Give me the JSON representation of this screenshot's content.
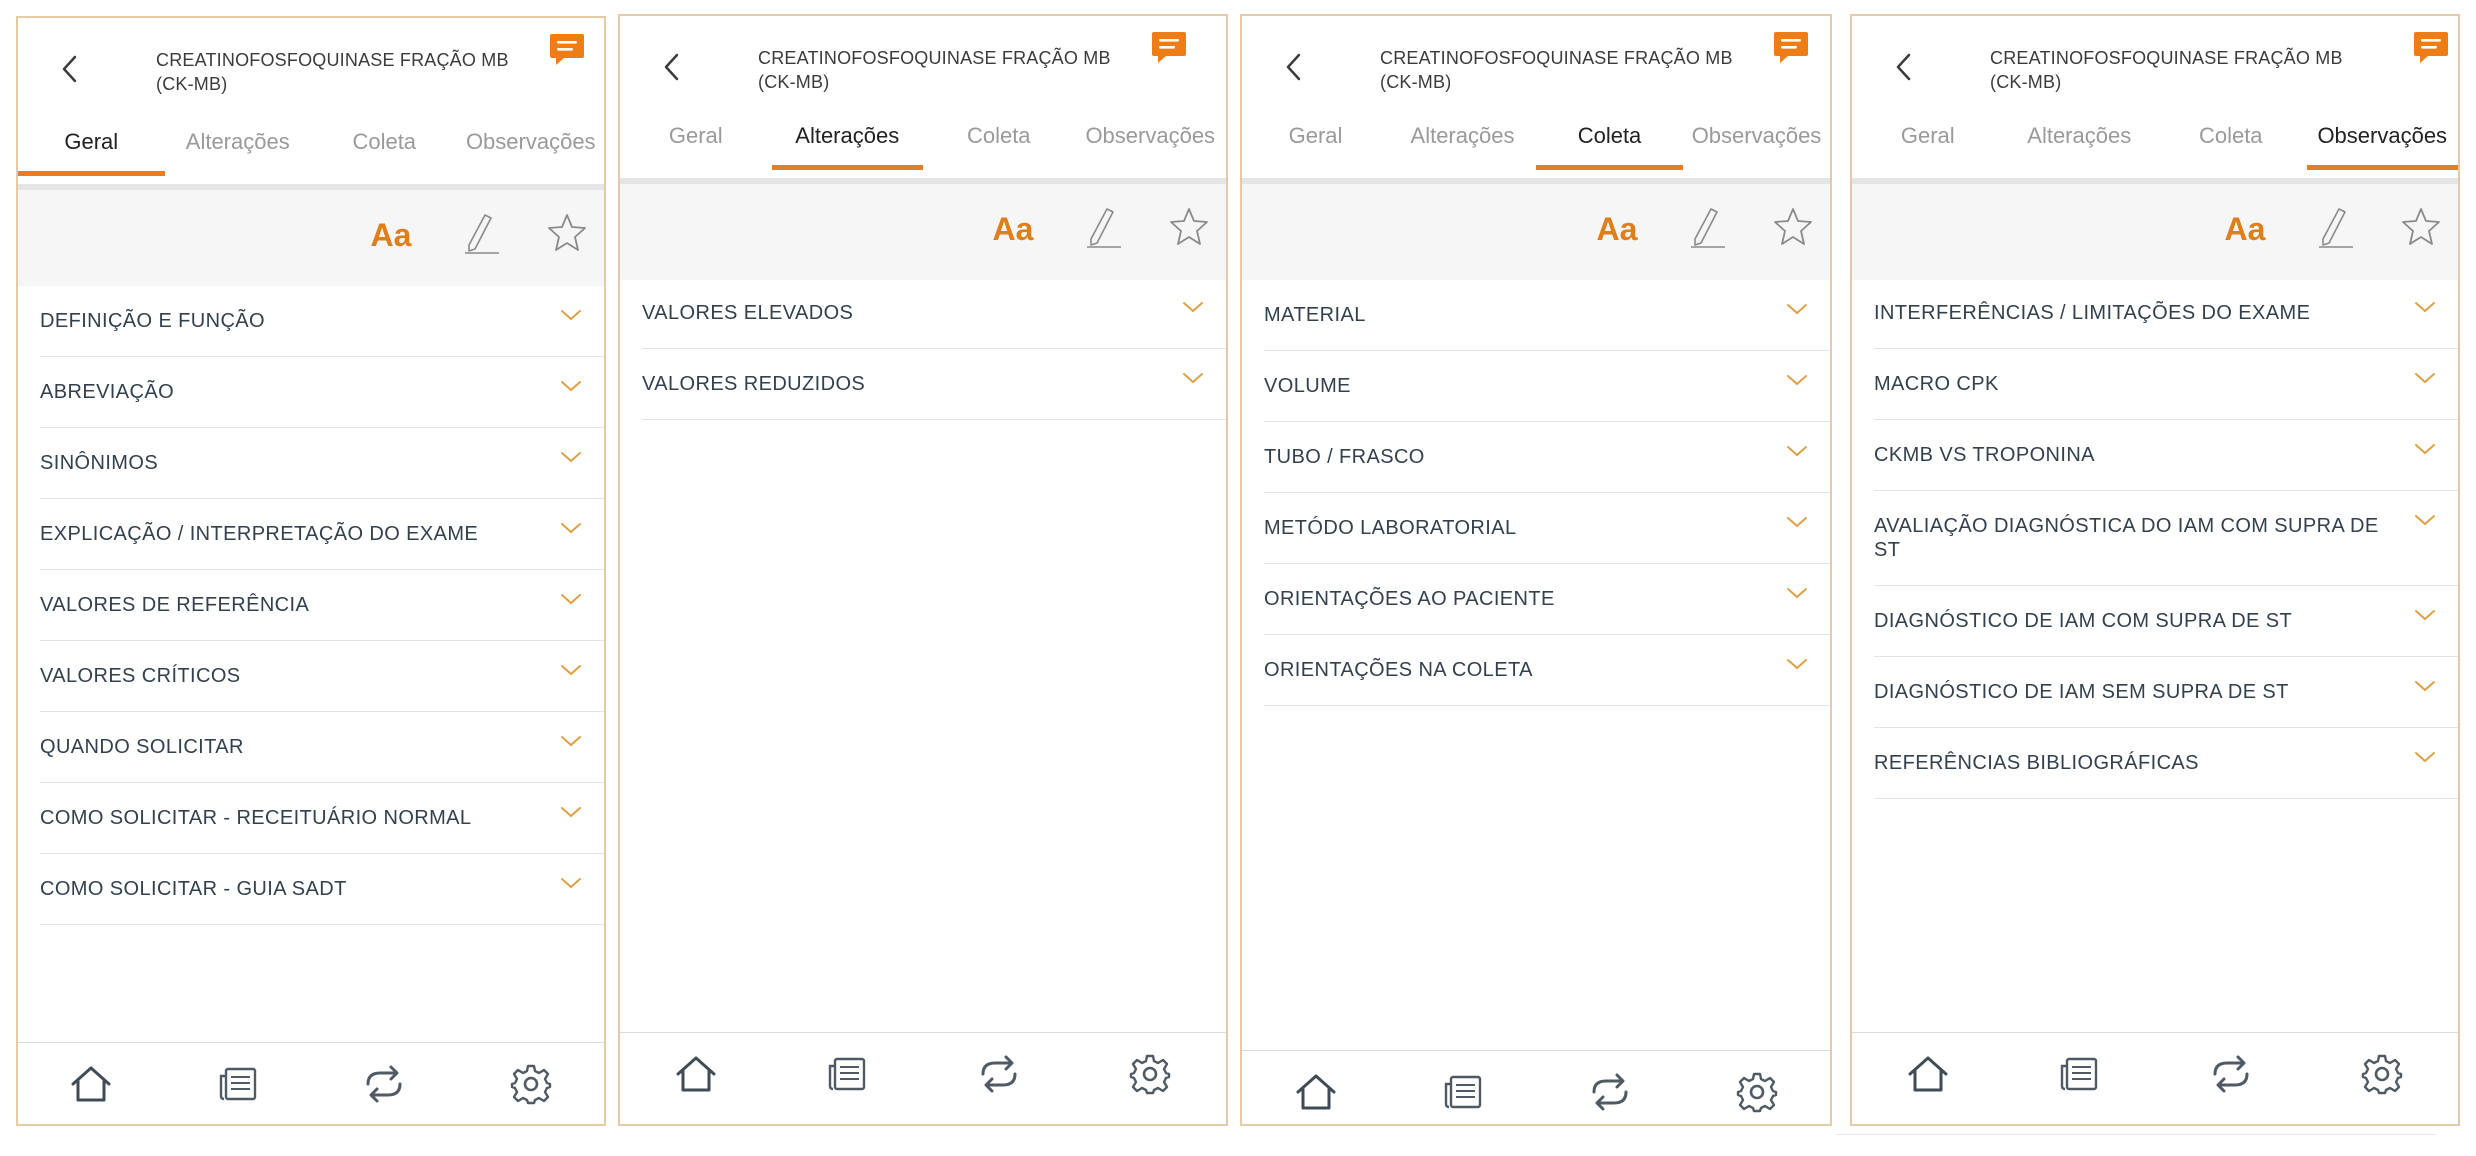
{
  "colors": {
    "accent": "#ec7d1f",
    "text": "#33404d",
    "tab_inactive": "#9a9a9a",
    "border": "#e6c9a6"
  },
  "icons": {
    "back": "chevron-left-icon",
    "chat": "chat-bubble-icon",
    "font_size": "font-size-icon",
    "pencil": "pencil-icon",
    "star": "star-icon",
    "chevron": "chevron-down-icon",
    "nav": [
      "home-icon",
      "news-icon",
      "refresh-icon",
      "gear-icon"
    ]
  },
  "header": {
    "title": "CREATINOFOSFOQUINASE FRAÇÃO MB (CK-MB)"
  },
  "tabs": [
    "Geral",
    "Alterações",
    "Coleta",
    "Observações"
  ],
  "toolbar": {
    "font_label": "Aa"
  },
  "panels": [
    {
      "active_tab": "Geral",
      "items": [
        "DEFINIÇÃO E FUNÇÃO",
        "ABREVIAÇÃO",
        "SINÔNIMOS",
        "EXPLICAÇÃO / INTERPRETAÇÃO DO EXAME",
        "VALORES DE REFERÊNCIA",
        "VALORES CRÍTICOS",
        "QUANDO SOLICITAR",
        "COMO SOLICITAR - RECEITUÁRIO NORMAL",
        "COMO SOLICITAR - GUIA SADT"
      ]
    },
    {
      "active_tab": "Alterações",
      "items": [
        "VALORES ELEVADOS",
        "VALORES REDUZIDOS"
      ]
    },
    {
      "active_tab": "Coleta",
      "items": [
        "MATERIAL",
        "VOLUME",
        "TUBO / FRASCO",
        "METÓDO LABORATORIAL",
        "ORIENTAÇÕES AO PACIENTE",
        "ORIENTAÇÕES NA COLETA"
      ]
    },
    {
      "active_tab": "Observações",
      "items": [
        "INTERFERÊNCIAS / LIMITAÇÕES DO EXAME",
        "MACRO CPK",
        "CKMB VS TROPONINA",
        "AVALIAÇÃO DIAGNÓSTICA DO IAM COM SUPRA DE ST",
        "DIAGNÓSTICO DE IAM COM SUPRA DE ST",
        "DIAGNÓSTICO DE IAM SEM SUPRA DE ST",
        "REFERÊNCIAS BIBLIOGRÁFICAS"
      ]
    }
  ]
}
